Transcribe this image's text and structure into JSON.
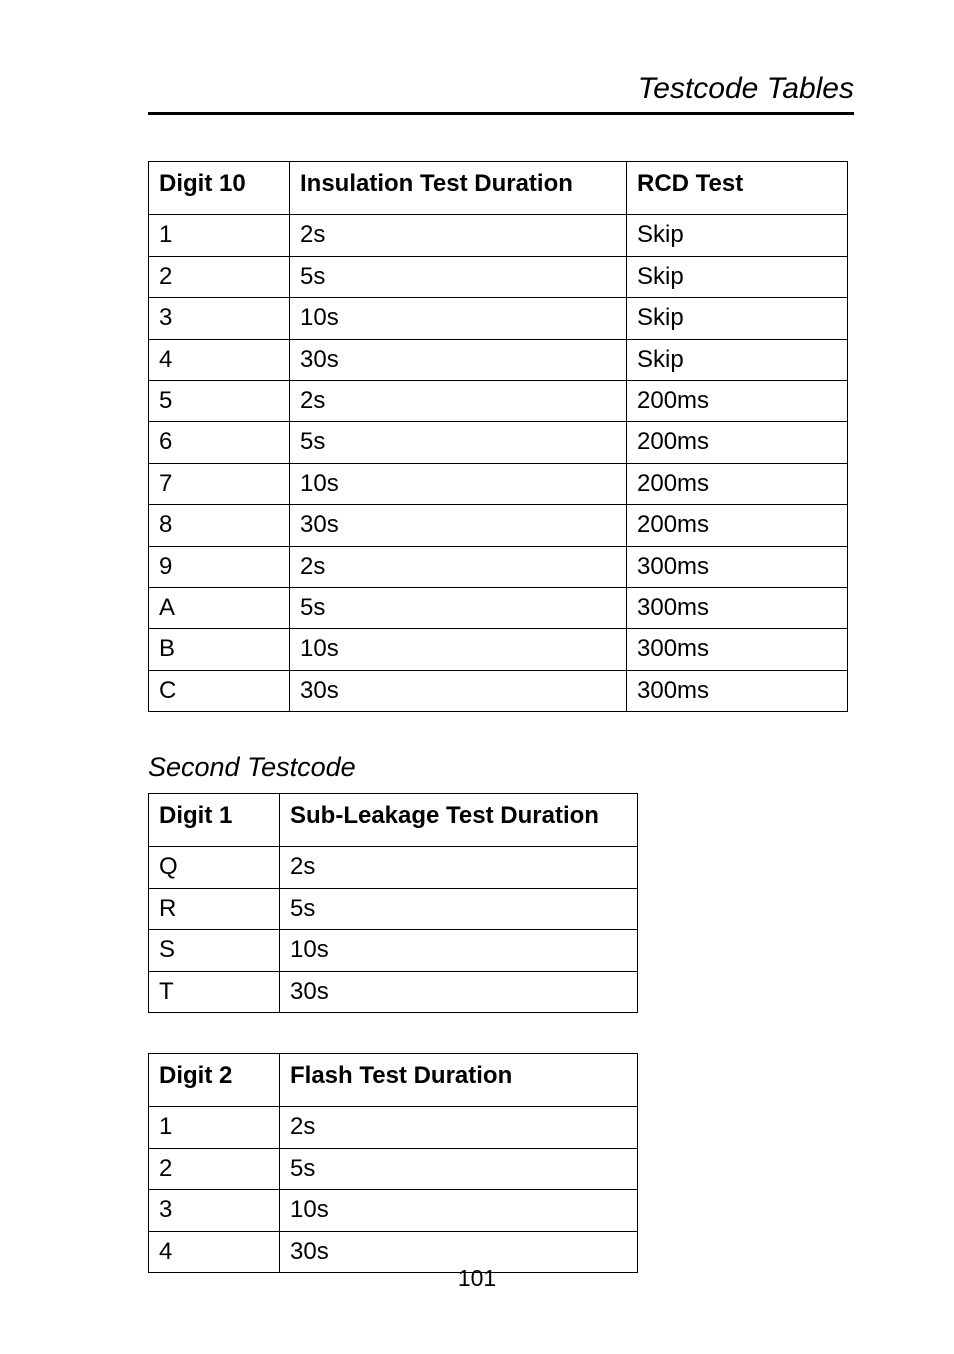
{
  "header": "Testcode Tables",
  "page_number": "101",
  "table1": {
    "headers": [
      "Digit 10",
      "Insulation Test Duration",
      "RCD Test"
    ],
    "rows": [
      [
        "1",
        "2s",
        "Skip"
      ],
      [
        "2",
        "5s",
        "Skip"
      ],
      [
        "3",
        "10s",
        "Skip"
      ],
      [
        "4",
        "30s",
        "Skip"
      ],
      [
        "5",
        "2s",
        "200ms"
      ],
      [
        "6",
        "5s",
        "200ms"
      ],
      [
        "7",
        "10s",
        "200ms"
      ],
      [
        "8",
        "30s",
        "200ms"
      ],
      [
        "9",
        "2s",
        "300ms"
      ],
      [
        "A",
        "5s",
        "300ms"
      ],
      [
        "B",
        "10s",
        "300ms"
      ],
      [
        "C",
        "30s",
        "300ms"
      ]
    ]
  },
  "section_title": "Second Testcode",
  "table2": {
    "headers": [
      "Digit 1",
      "Sub-Leakage Test Duration"
    ],
    "rows": [
      [
        "Q",
        "2s"
      ],
      [
        "R",
        "5s"
      ],
      [
        "S",
        "10s"
      ],
      [
        "T",
        "30s"
      ]
    ]
  },
  "table3": {
    "headers": [
      "Digit 2",
      "Flash Test Duration"
    ],
    "rows": [
      [
        "1",
        "2s"
      ],
      [
        "2",
        "5s"
      ],
      [
        "3",
        "10s"
      ],
      [
        "4",
        "30s"
      ]
    ]
  }
}
